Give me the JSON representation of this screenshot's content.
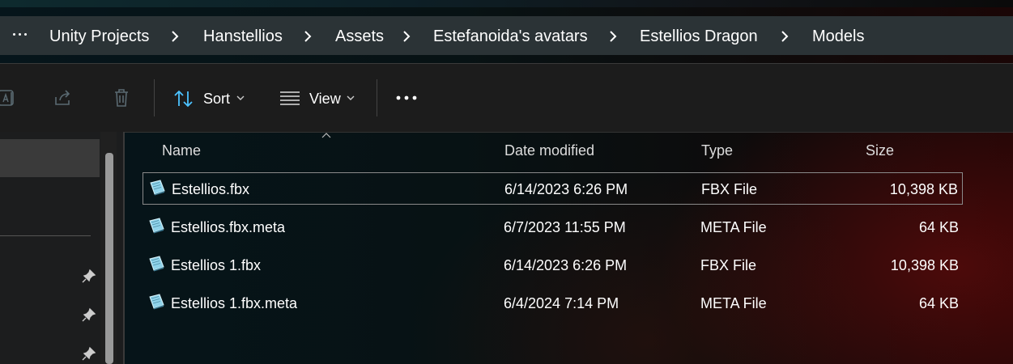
{
  "breadcrumb": {
    "items": [
      "Unity Projects",
      "Hanstellios",
      "Assets",
      "Estefanoida's avatars",
      "Estellios Dragon",
      "Models"
    ]
  },
  "toolbar": {
    "sort_label": "Sort",
    "view_label": "View"
  },
  "columns": {
    "name": "Name",
    "date": "Date modified",
    "type": "Type",
    "size": "Size"
  },
  "files": [
    {
      "name": "Estellios.fbx",
      "date": "6/14/2023 6:26 PM",
      "type": "FBX File",
      "size": "10,398 KB",
      "selected": true
    },
    {
      "name": "Estellios.fbx.meta",
      "date": "6/7/2023 11:55 PM",
      "type": "META File",
      "size": "64 KB",
      "selected": false
    },
    {
      "name": "Estellios 1.fbx",
      "date": "6/14/2023 6:26 PM",
      "type": "FBX File",
      "size": "10,398 KB",
      "selected": false
    },
    {
      "name": "Estellios 1.fbx.meta",
      "date": "6/4/2024 7:14 PM",
      "type": "META File",
      "size": "64 KB",
      "selected": false
    }
  ],
  "colors": {
    "accent": "#4cc2ff",
    "selection_border": "#8a8a8a"
  }
}
